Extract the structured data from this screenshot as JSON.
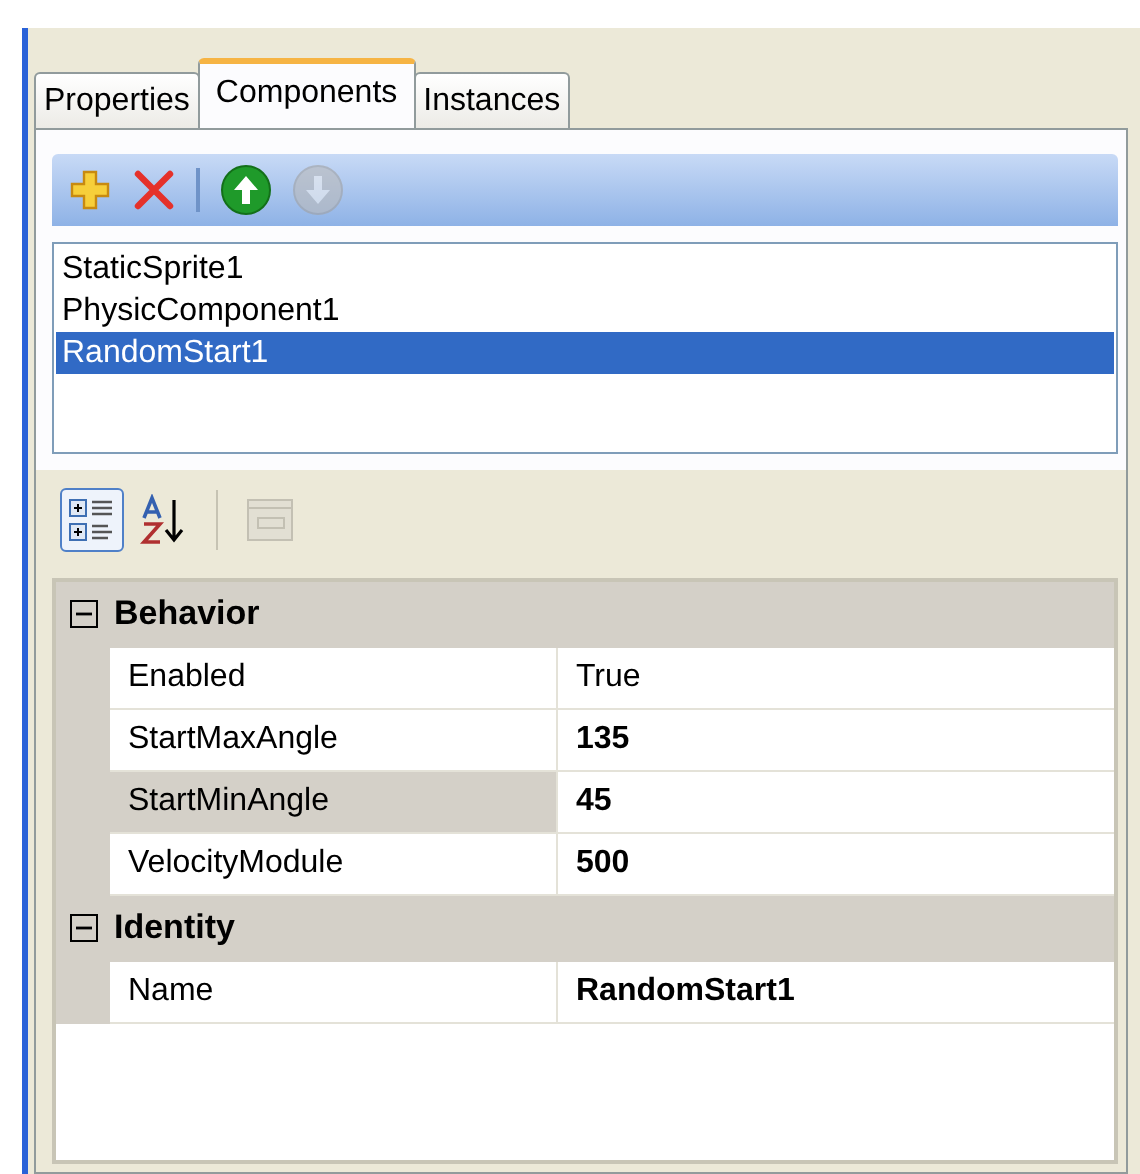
{
  "tabs": [
    {
      "label": "Properties",
      "selected": false
    },
    {
      "label": "Components",
      "selected": true
    },
    {
      "label": "Instances",
      "selected": false
    }
  ],
  "component_toolbar": [
    {
      "kind": "add",
      "disabled": false
    },
    {
      "kind": "delete",
      "disabled": false
    },
    {
      "kind": "separator"
    },
    {
      "kind": "move-up",
      "disabled": false
    },
    {
      "kind": "move-down",
      "disabled": true
    }
  ],
  "components": [
    {
      "label": "StaticSprite1",
      "selected": false
    },
    {
      "label": "PhysicComponent1",
      "selected": false
    },
    {
      "label": "RandomStart1",
      "selected": true
    }
  ],
  "grid_toolbar": [
    {
      "kind": "categorized",
      "selected": true,
      "disabled": false
    },
    {
      "kind": "alphabetical",
      "selected": false,
      "disabled": false
    },
    {
      "kind": "separator"
    },
    {
      "kind": "property-pages",
      "selected": false,
      "disabled": true
    }
  ],
  "categories": [
    {
      "name": "Behavior",
      "expanded": true,
      "properties": [
        {
          "name": "Enabled",
          "value": "True",
          "modified": false,
          "selected": false
        },
        {
          "name": "StartMaxAngle",
          "value": "135",
          "modified": true,
          "selected": false
        },
        {
          "name": "StartMinAngle",
          "value": "45",
          "modified": true,
          "selected": true
        },
        {
          "name": "VelocityModule",
          "value": "500",
          "modified": true,
          "selected": false
        }
      ]
    },
    {
      "name": "Identity",
      "expanded": true,
      "properties": [
        {
          "name": "Name",
          "value": "RandomStart1",
          "modified": true,
          "selected": false
        }
      ]
    }
  ]
}
